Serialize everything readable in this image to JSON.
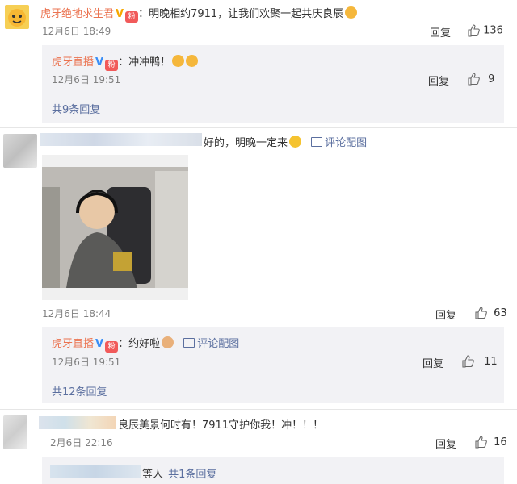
{
  "comments": [
    {
      "user": "虎牙绝地求生君",
      "text": "：明晚相约7911，让我们欢聚一起共庆良辰",
      "time": "12月6日 18:49",
      "reply": "回复",
      "likes": "136",
      "sub_reply": {
        "user": "虎牙直播",
        "text": "：冲冲鸭！",
        "time": "12月6日 19:51",
        "reply": "回复",
        "likes": "9"
      },
      "more": "共9条回复"
    },
    {
      "text": "好的，明晚一定来",
      "pic_link": "评论配图",
      "time": "12月6日 18:44",
      "reply": "回复",
      "likes": "63",
      "sub_reply": {
        "user": "虎牙直播",
        "text": "：约好啦",
        "pic_link": "评论配图",
        "time": "12月6日 19:51",
        "reply": "回复",
        "likes": "11"
      },
      "more": "共12条回复"
    },
    {
      "text": "良辰美景何时有！7911守护你我！冲！！！",
      "time": "2月6日 22:16",
      "reply": "回复",
      "likes": "16",
      "more_partial": "等人",
      "more": "共1条回复"
    }
  ],
  "colors": {
    "link": "#eb7350",
    "blue_link": "#5b6f9f",
    "sub_bg": "#f2f2f5"
  }
}
